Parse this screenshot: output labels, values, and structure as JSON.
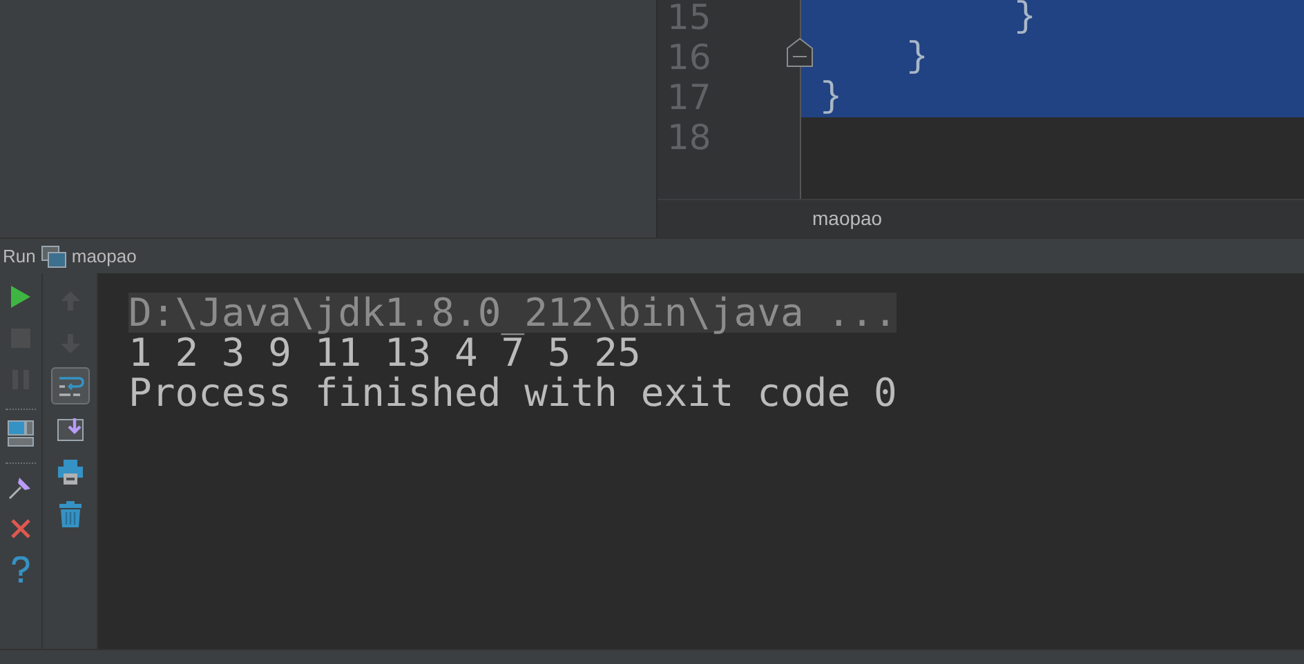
{
  "editor": {
    "lines": [
      {
        "number": "15",
        "code": "         }",
        "selected": true
      },
      {
        "number": "16",
        "code": "    }",
        "selected": true
      },
      {
        "number": "17",
        "code": "}",
        "selected": true
      },
      {
        "number": "18",
        "selected": false
      }
    ],
    "breadcrumb": "maopao"
  },
  "run_panel": {
    "title": "Run",
    "config": "maopao",
    "left_toolbar": [
      {
        "kind": "run",
        "disabled": false
      },
      {
        "kind": "stop",
        "disabled": true
      },
      {
        "kind": "pause",
        "disabled": true
      },
      {
        "kind": "layout",
        "disabled": false
      },
      {
        "kind": "pin",
        "disabled": false
      },
      {
        "kind": "close",
        "disabled": false
      },
      {
        "kind": "help",
        "disabled": false
      }
    ],
    "side_toolbar": [
      {
        "kind": "up",
        "disabled": true,
        "on": false
      },
      {
        "kind": "down",
        "disabled": true,
        "on": false
      },
      {
        "kind": "wrap",
        "disabled": false,
        "on": true
      },
      {
        "kind": "scroll-end",
        "disabled": false,
        "on": false
      },
      {
        "kind": "print",
        "disabled": false,
        "on": false
      },
      {
        "kind": "trash",
        "disabled": false,
        "on": false
      }
    ],
    "console": [
      {
        "kind": "command",
        "text": "D:\\Java\\jdk1.8.0_212\\bin\\java ..."
      },
      {
        "kind": "output",
        "text": "1 2 3 9 11 13 4 7 5 25"
      },
      {
        "kind": "output",
        "text": "Process finished with exit code 0"
      }
    ]
  }
}
